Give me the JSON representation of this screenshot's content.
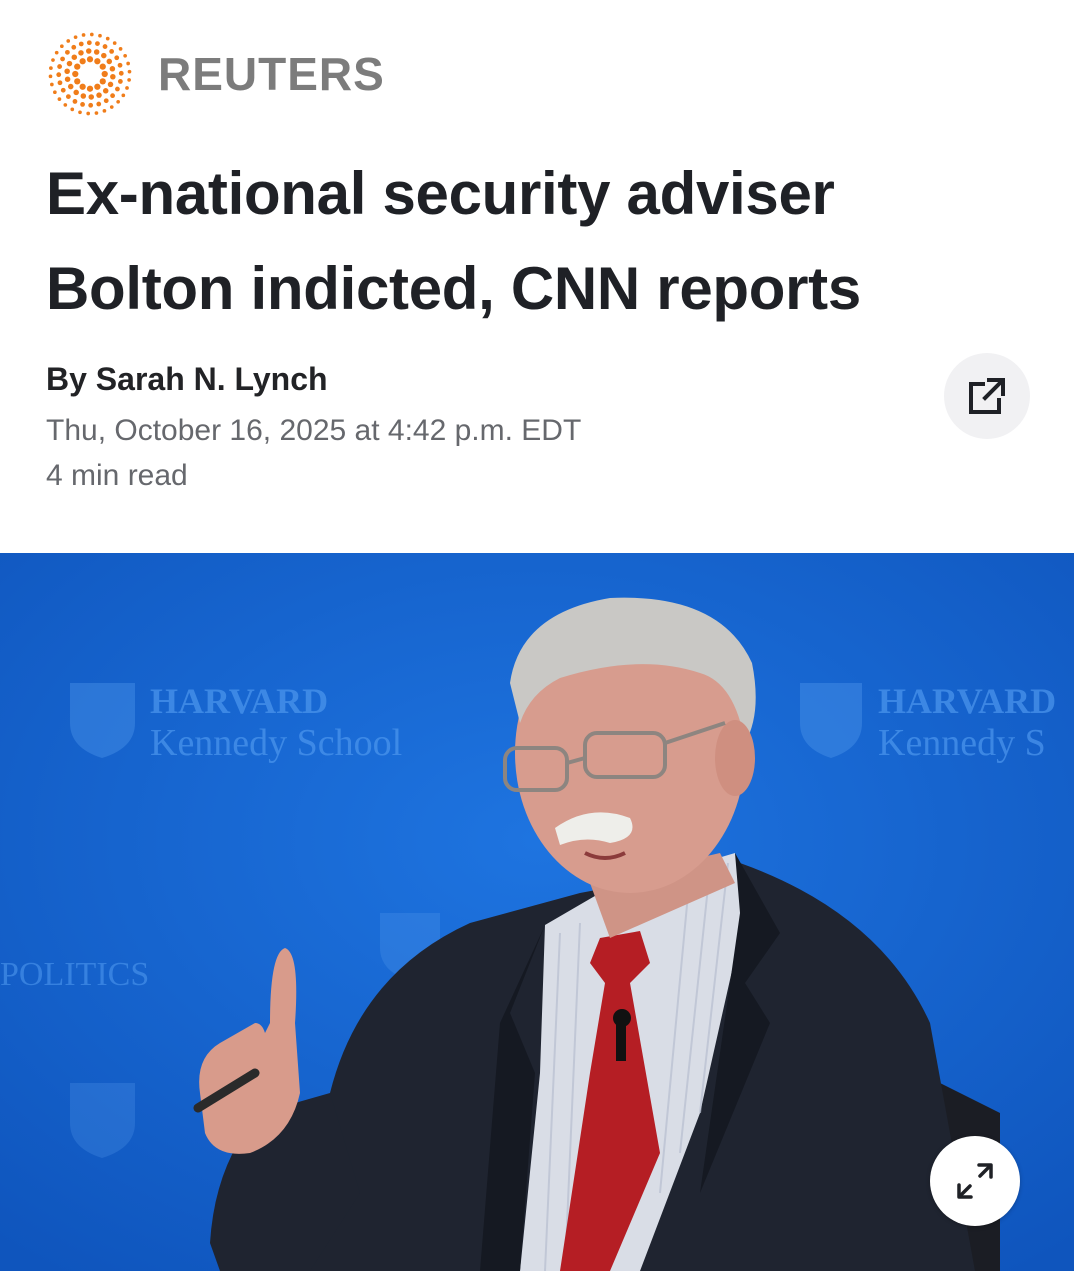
{
  "brand": {
    "name": "REUTERS",
    "logo_icon": "reuters-dot-ring-logo",
    "logo_color": "#f07d1a"
  },
  "article": {
    "headline_line1": "Ex-national security adviser",
    "headline_line2": "Bolton indicted, CNN reports",
    "byline": "By Sarah N. Lynch",
    "published": "Thu, October 16, 2025 at 4:42 p.m. EDT",
    "read_time": "4 min read"
  },
  "share": {
    "icon": "external-link-icon"
  },
  "hero_image": {
    "backdrop_left_line1": "HARVARD",
    "backdrop_left_line2": "Kennedy School",
    "backdrop_right_line1": "HARVARD",
    "backdrop_right_line2": "Kennedy S",
    "backdrop_side": "POLITICS",
    "background_color": "#1565d2",
    "expand_icon": "expand-diagonal-icon"
  }
}
